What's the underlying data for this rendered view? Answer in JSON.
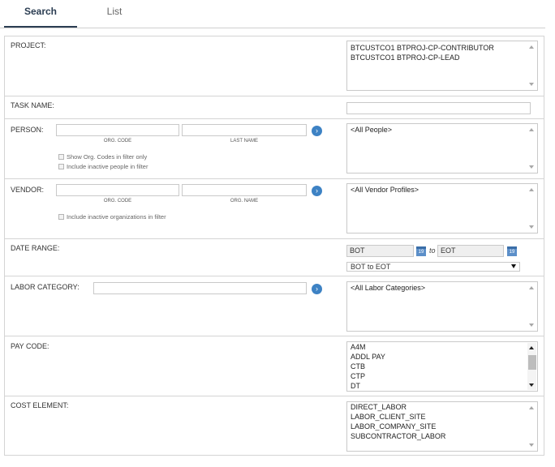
{
  "tabs": [
    {
      "label": "Search",
      "active": true
    },
    {
      "label": "List",
      "active": false
    }
  ],
  "project": {
    "label": "PROJECT:",
    "items": [
      "BTCUSTCO1 BTPROJ-CP-CONTRIBUTOR",
      "BTCUSTCO1 BTPROJ-CP-LEAD"
    ]
  },
  "task_name": {
    "label": "TASK NAME:",
    "value": ""
  },
  "person": {
    "label": "PERSON:",
    "org_code_caption": "ORG. CODE",
    "last_name_caption": "LAST NAME",
    "show_org_codes": "Show Org. Codes in filter only",
    "include_inactive_people": "Include inactive people in filter",
    "items": [
      "<All People>"
    ]
  },
  "vendor": {
    "label": "VENDOR:",
    "org_code_caption": "ORG. CODE",
    "org_name_caption": "ORG. NAME",
    "include_inactive_orgs": "Include inactive organizations in filter",
    "items": [
      "<All Vendor Profiles>"
    ]
  },
  "date_range": {
    "label": "DATE RANGE:",
    "from": "BOT",
    "to_word": "to",
    "to": "EOT",
    "preset": "BOT to EOT",
    "cal_text": "19"
  },
  "labor_category": {
    "label": "LABOR CATEGORY:",
    "items": [
      "<All Labor Categories>"
    ]
  },
  "pay_code": {
    "label": "PAY CODE:",
    "items": [
      "A4M",
      "ADDL PAY",
      "CTB",
      "CTP",
      "DT"
    ]
  },
  "cost_element": {
    "label": "COST ELEMENT:",
    "items": [
      "DIRECT_LABOR",
      "LABOR_CLIENT_SITE",
      "LABOR_COMPANY_SITE",
      "SUBCONTRACTOR_LABOR"
    ]
  },
  "colors": {
    "accent": "#3d82c4",
    "tab_active": "#2b3d52",
    "border": "#d4d4d4"
  },
  "icons": {
    "go": "arrow-right-icon",
    "calendar": "calendar-icon",
    "dropdown": "chevron-down-icon"
  }
}
